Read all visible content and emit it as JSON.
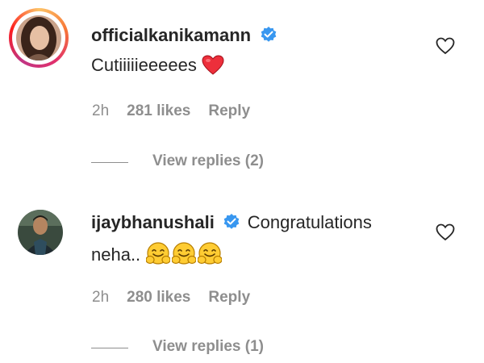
{
  "comments": [
    {
      "username": "officialkanikamann",
      "text": "Cutiiiiieeeees",
      "time": "2h",
      "likes": "281 likes",
      "reply": "Reply",
      "view_replies": "View replies (2)",
      "verified": true,
      "trailing_emoji": "heart-emoji"
    },
    {
      "username": "ijaybhanushali",
      "text_line1": "Congratulations",
      "text_line2": "neha..",
      "time": "2h",
      "likes": "280 likes",
      "reply": "Reply",
      "view_replies": "View replies (1)",
      "verified": true,
      "trailing_emoji": "hugging-face-emoji x3"
    }
  ],
  "colors": {
    "text": "#262626",
    "muted": "#8e8e8e",
    "verified_blue": "#3897f0",
    "heart_red": "#ed2f3b"
  }
}
